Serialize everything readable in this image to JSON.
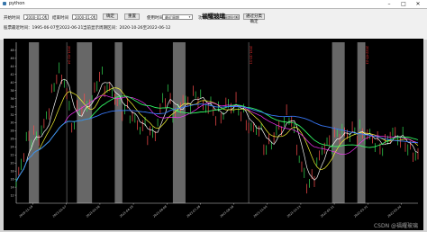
{
  "window": {
    "title": "python"
  },
  "toolbar": {
    "start_label": "开始时间",
    "start_value": "2000-01-01",
    "end_label": "结束时间",
    "end_value": "2000-01-01",
    "confirm_label": "确定",
    "reset_label": "重置",
    "period_label": "使用时间",
    "period_value": "最近周期",
    "func_label": "功能",
    "func_value": "移动最多周期时间",
    "func_button_label": "通过分类确定",
    "info_left": "股票最近时间：1995-06-07至2022-06-21",
    "info_right": "当前显示周期区间：2020-10-26至2022-06-12"
  },
  "chart_title": "福耀玻璃",
  "chart_data": {
    "type": "line",
    "title": "福耀玻璃",
    "ylim": [
      10,
      50
    ],
    "yticks": [
      12,
      14,
      16,
      18,
      20,
      22,
      24,
      26,
      28,
      30,
      32,
      34,
      36,
      38,
      40,
      42,
      44,
      46,
      48
    ],
    "xticks": [
      "2020-11-19",
      "2021-01-07",
      "2021-02-26",
      "2021-04-19",
      "2021-06-08",
      "2021-07-28",
      "2021-09-16",
      "2021-11-04",
      "2021-12-23",
      "2022-02-11",
      "2022-03-31",
      "2022-05-20"
    ],
    "price_anchors": [
      [
        0,
        14
      ],
      [
        4,
        26
      ],
      [
        7,
        26
      ],
      [
        10,
        28
      ],
      [
        13,
        33
      ],
      [
        16,
        43
      ],
      [
        19,
        40
      ],
      [
        22,
        30
      ],
      [
        25,
        33
      ],
      [
        28,
        35
      ],
      [
        31,
        37
      ],
      [
        33,
        42
      ],
      [
        35,
        40
      ],
      [
        37,
        38
      ],
      [
        39,
        36
      ],
      [
        42,
        34
      ],
      [
        45,
        32
      ],
      [
        48,
        30
      ],
      [
        51,
        28
      ],
      [
        54,
        27
      ],
      [
        56,
        30
      ],
      [
        58,
        35
      ],
      [
        60,
        38
      ],
      [
        63,
        31
      ],
      [
        66,
        36
      ],
      [
        69,
        35
      ],
      [
        72,
        37
      ],
      [
        75,
        34
      ],
      [
        78,
        33
      ],
      [
        81,
        32
      ],
      [
        84,
        34
      ],
      [
        87,
        35
      ],
      [
        90,
        31
      ],
      [
        93,
        29
      ],
      [
        96,
        28
      ],
      [
        99,
        24
      ],
      [
        102,
        26
      ],
      [
        105,
        30
      ],
      [
        108,
        32
      ],
      [
        110,
        27
      ],
      [
        112,
        22
      ],
      [
        114,
        16
      ],
      [
        116,
        14
      ],
      [
        119,
        20
      ],
      [
        122,
        24
      ],
      [
        125,
        26
      ],
      [
        128,
        27
      ],
      [
        131,
        28
      ],
      [
        134,
        27
      ],
      [
        137,
        28
      ],
      [
        140,
        26
      ],
      [
        143,
        25
      ],
      [
        146,
        24
      ],
      [
        149,
        28
      ],
      [
        152,
        26
      ],
      [
        155,
        24
      ],
      [
        158,
        22
      ]
    ],
    "n_points": 160,
    "ma_periods": [
      5,
      10,
      20,
      30,
      60
    ],
    "series_colors": [
      "#ffffff",
      "#ffff33",
      "#ff33ff",
      "#33ff66",
      "#3a7bff"
    ],
    "shaded_ranges": [
      [
        5,
        9
      ],
      [
        24,
        30
      ],
      [
        39,
        42
      ],
      [
        62,
        67
      ],
      [
        125,
        130
      ],
      [
        135,
        138
      ]
    ],
    "shaded_color": "#8a8a8a",
    "markers": [
      [
        20,
        "2021-02-24"
      ],
      [
        92,
        "2021-10-11"
      ],
      [
        138,
        "2022-05-23"
      ]
    ],
    "marker_color": "#ff3333"
  },
  "watermark": "CSDN @福耀玻璃"
}
